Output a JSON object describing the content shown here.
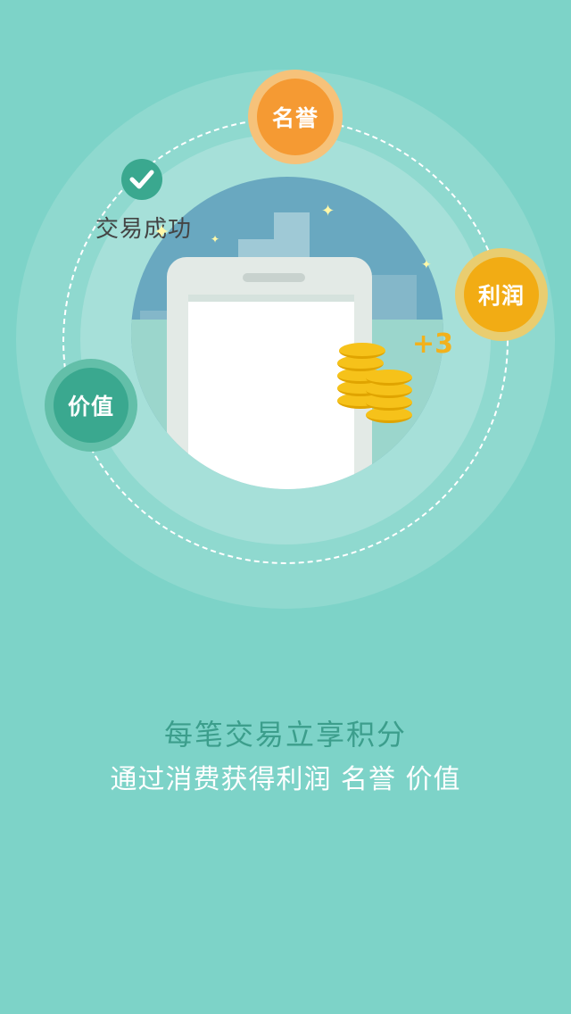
{
  "illustration": {
    "success_text": "交易成功",
    "bonus_text": "+3",
    "badges": {
      "fame": {
        "label": "名誉",
        "color": "#f59a33",
        "ring": "#f6c27a"
      },
      "profit": {
        "label": "利润",
        "color": "#f2ac14",
        "ring": "#e9cd70"
      },
      "value": {
        "label": "价值",
        "color": "#3aa88f",
        "ring": "#63bfa9"
      }
    },
    "icons": [
      "check-icon",
      "coin-stack-icon",
      "sparkle-icon"
    ]
  },
  "headline": "每笔交易立享积分",
  "subline": "通过消费获得利润  名誉 价值",
  "colors": {
    "background": "#7dd3c8",
    "headline": "#3c9e8c",
    "subline": "#ffffff"
  }
}
